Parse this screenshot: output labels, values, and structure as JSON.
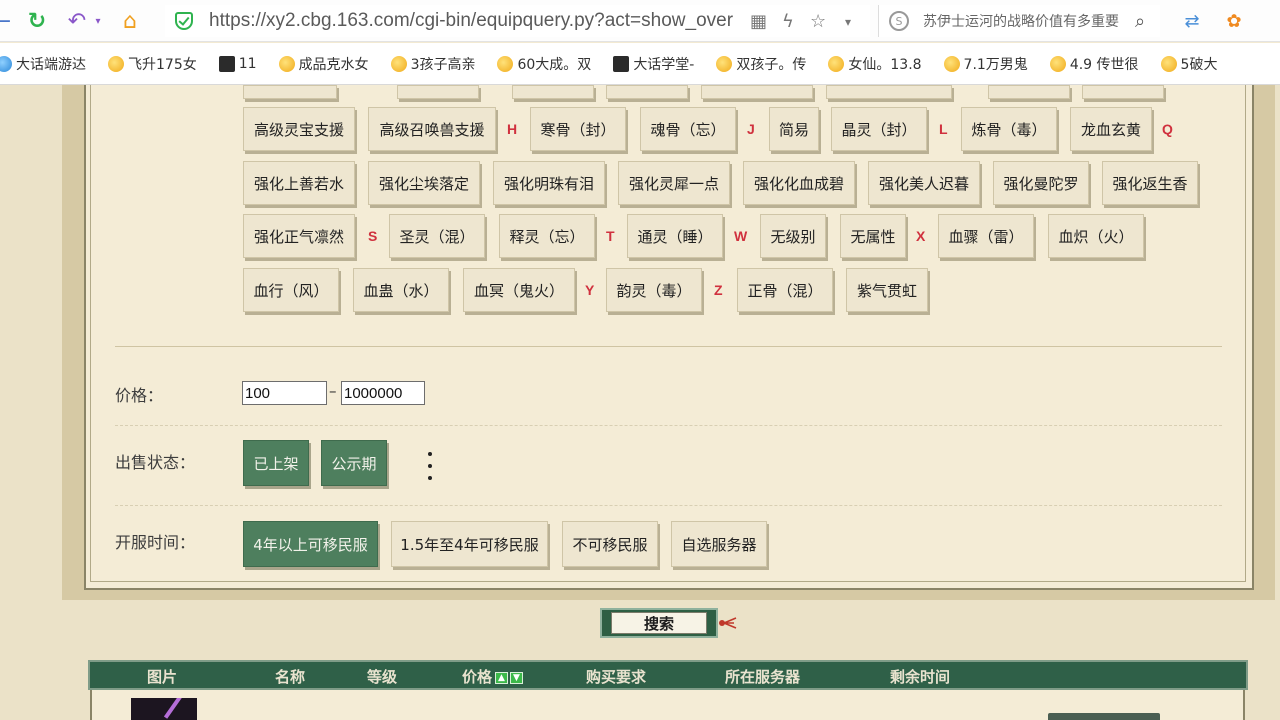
{
  "browser": {
    "url": "https://xy2.cbg.163.com/cgi-bin/equipquery.py?act=show_over",
    "search_text": "苏伊士运河的战略价值有多重要",
    "search_engine_label": "S"
  },
  "bookmarks": [
    {
      "label": "大话端游达",
      "icon": "blue"
    },
    {
      "label": "飞升175女",
      "icon": "star"
    },
    {
      "label": "11",
      "icon": "dark"
    },
    {
      "label": "成品克水女",
      "icon": "star"
    },
    {
      "label": "3孩子高亲",
      "icon": "star"
    },
    {
      "label": "60大成。双",
      "icon": "star"
    },
    {
      "label": "大话学堂-",
      "icon": "dark"
    },
    {
      "label": "双孩子。传",
      "icon": "star"
    },
    {
      "label": "女仙。13.8",
      "icon": "star"
    },
    {
      "label": "7.1万男鬼",
      "icon": "star"
    },
    {
      "label": "4.9 传世很",
      "icon": "star"
    },
    {
      "label": "5破大",
      "icon": "star"
    }
  ],
  "equip_buttons": {
    "row1": [
      "高级灵宝支援",
      "高级召唤兽支援",
      "寒骨（封）",
      "魂骨（忘）",
      "简易",
      "晶灵（封）",
      "炼骨（毒）",
      "龙血玄黄"
    ],
    "row2": [
      "强化上善若水",
      "强化尘埃落定",
      "强化明珠有泪",
      "强化灵犀一点",
      "强化化血成碧",
      "强化美人迟暮",
      "强化曼陀罗",
      "强化返生香"
    ],
    "row3": [
      "强化正气凛然",
      "圣灵（混）",
      "释灵（忘）",
      "通灵（睡）",
      "无级别",
      "无属性",
      "血骤（雷）",
      "血炽（火）"
    ],
    "row4": [
      "血行（风）",
      "血蛊（水）",
      "血冥（鬼火）",
      "韵灵（毒）",
      "正骨（混）",
      "紫气贯虹"
    ]
  },
  "letters": [
    "H",
    "J",
    "L",
    "Q",
    "S",
    "T",
    "W",
    "X",
    "Y",
    "Z"
  ],
  "price": {
    "label": "价格：",
    "min": "100",
    "max": "1000000",
    "separator": "–"
  },
  "sale_status": {
    "label": "出售状态：",
    "options": [
      "已上架",
      "公示期"
    ]
  },
  "server_time": {
    "label": "开服时间：",
    "options": [
      "4年以上可移民服",
      "1.5年至4年可移民服",
      "不可移民服",
      "自选服务器"
    ]
  },
  "search_button": "搜索",
  "result_columns": [
    "图片",
    "名称",
    "等级",
    "价格",
    "购买要求",
    "所在服务器",
    "剩余时间"
  ],
  "sort_arrows": [
    "▲",
    "▼"
  ],
  "colors": {
    "accent_green": "#4e7f5e",
    "header_green": "#2f6048",
    "letter_red": "#d0313e"
  }
}
